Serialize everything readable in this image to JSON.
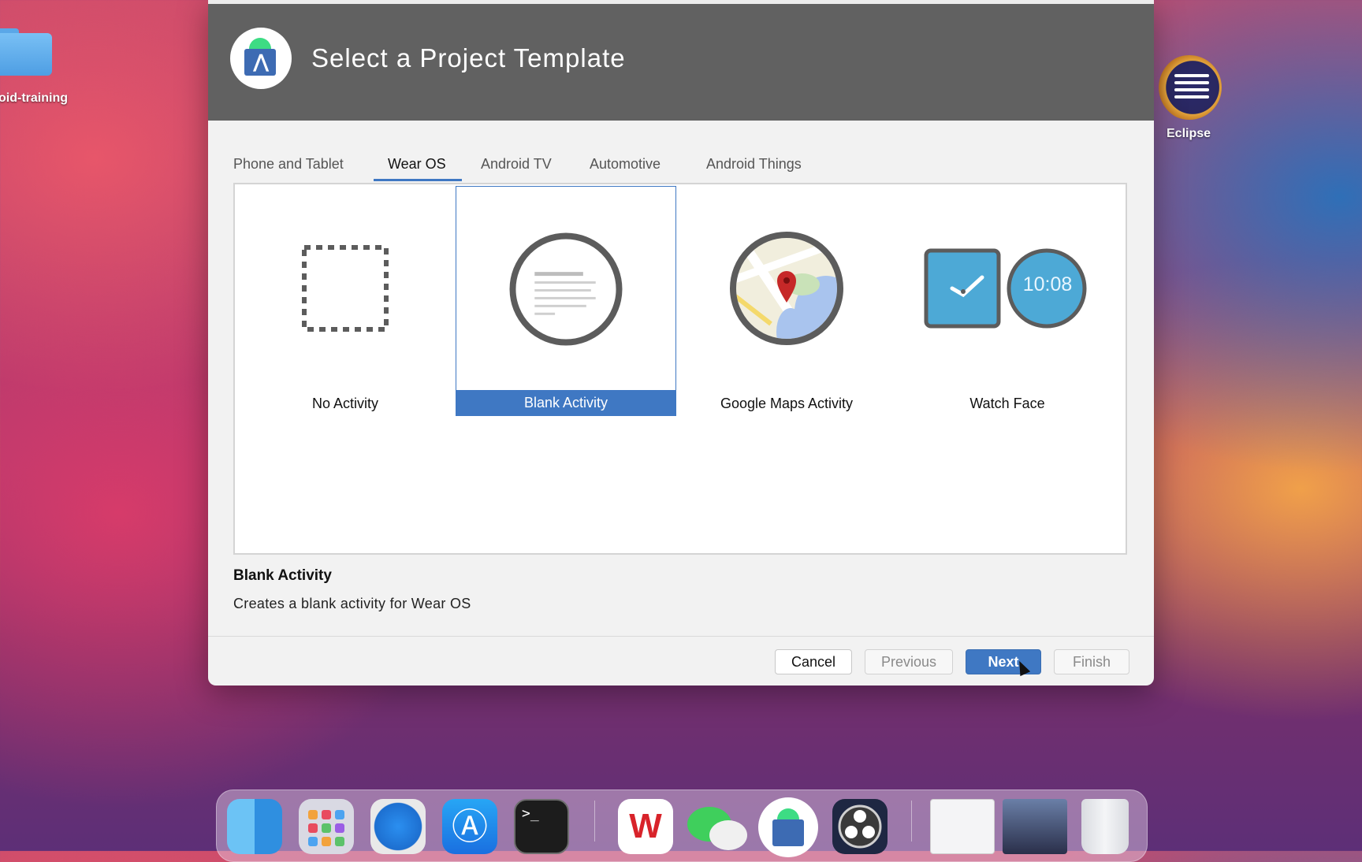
{
  "desktop": {
    "folder_label": "oid-training",
    "eclipse_label": "Eclipse"
  },
  "dialog": {
    "title": "Select a Project Template",
    "tabs": [
      {
        "label": "Phone and Tablet",
        "active": false
      },
      {
        "label": "Wear OS",
        "active": true
      },
      {
        "label": "Android TV",
        "active": false
      },
      {
        "label": "Automotive",
        "active": false
      },
      {
        "label": "Android Things",
        "active": false
      }
    ],
    "templates": [
      {
        "label": "No Activity",
        "selected": false
      },
      {
        "label": "Blank Activity",
        "selected": true
      },
      {
        "label": "Google Maps Activity",
        "selected": false
      },
      {
        "label": "Watch Face",
        "selected": false
      }
    ],
    "watch_time": "10:08",
    "description": {
      "title": "Blank Activity",
      "text": "Creates a blank activity for Wear OS"
    },
    "buttons": {
      "cancel": "Cancel",
      "previous": "Previous",
      "next": "Next",
      "finish": "Finish"
    },
    "colors": {
      "accent": "#3f78c3",
      "header": "#616161"
    }
  },
  "dock": {
    "apps": [
      "finder-icon",
      "launchpad-icon",
      "safari-icon",
      "app-store-icon",
      "terminal-icon",
      "wps-office-icon",
      "wechat-icon",
      "android-studio-icon",
      "obs-icon",
      "preview-window-icon",
      "photos-window-icon",
      "trash-icon"
    ]
  }
}
